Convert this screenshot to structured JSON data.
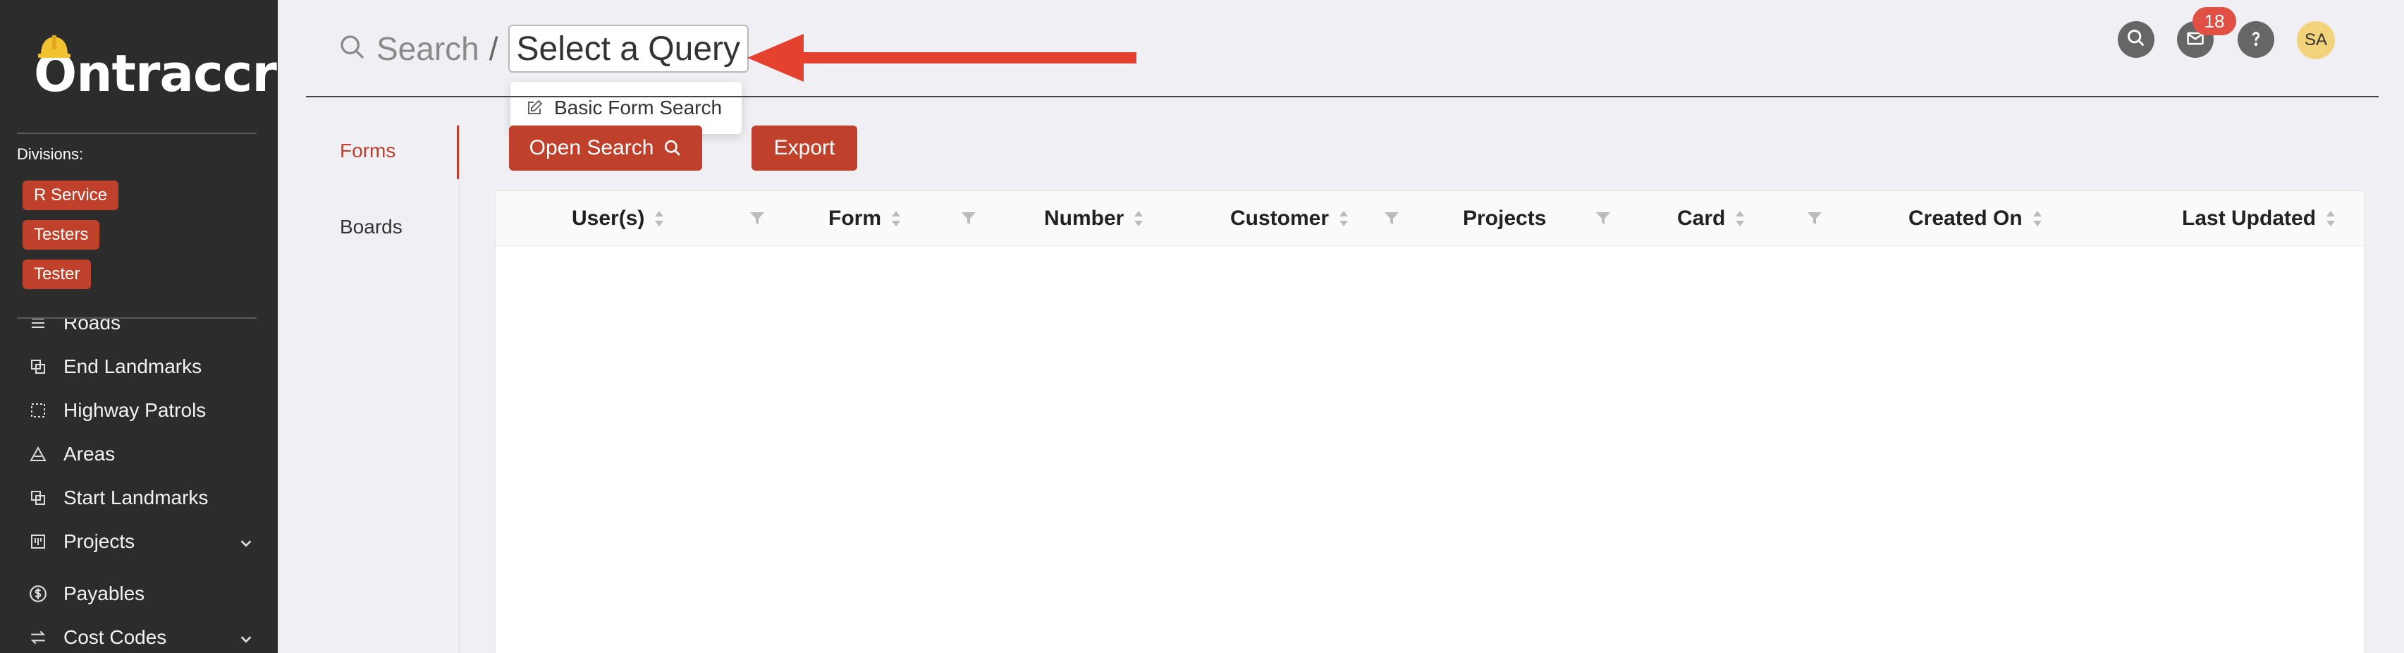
{
  "app": {
    "logo": "Ontraccr"
  },
  "sidebar": {
    "divisions_label": "Divisions:",
    "divisions": [
      "R Service",
      "Testers",
      "Tester"
    ],
    "items": [
      {
        "label": "Roads",
        "icon": "road-icon"
      },
      {
        "label": "End Landmarks",
        "icon": "landmark-icon"
      },
      {
        "label": "Highway Patrols",
        "icon": "dashed-square-icon"
      },
      {
        "label": "Areas",
        "icon": "triangle-area-icon"
      },
      {
        "label": "Start Landmarks",
        "icon": "landmark-icon"
      },
      {
        "label": "Projects",
        "icon": "project-board-icon",
        "expandable": true
      },
      {
        "label": "Payables",
        "icon": "dollar-circle-icon"
      },
      {
        "label": "Cost Codes",
        "icon": "swap-icon",
        "expandable": true
      }
    ]
  },
  "header": {
    "search_label": "Search",
    "slash": "/",
    "query_select": "Select a Query",
    "query_options": [
      "Basic Form Search"
    ],
    "notification_count": "18",
    "avatar_initials": "SA",
    "icons": [
      "search-icon",
      "mail-icon",
      "help-icon"
    ]
  },
  "tabs": [
    "Forms",
    "Boards"
  ],
  "active_tab": "Forms",
  "actions": {
    "open_search": "Open Search",
    "export": "Export"
  },
  "table": {
    "columns": [
      "User(s)",
      "Form",
      "Number",
      "Customer",
      "Projects",
      "Card",
      "Created On",
      "Last Updated"
    ],
    "rows": []
  },
  "colors": {
    "accent": "#c0412b",
    "sidebar_bg": "#2c2c2c",
    "badge": "#e15044",
    "arrow": "#e5412f"
  }
}
